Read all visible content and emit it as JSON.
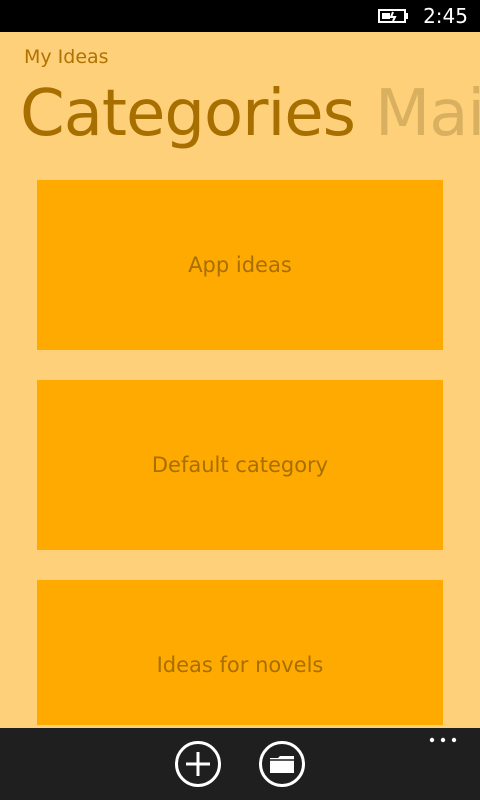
{
  "status_bar": {
    "time": "2:45",
    "battery_icon": "battery-charging-icon"
  },
  "app": {
    "title": "My Ideas"
  },
  "pivot": {
    "items": [
      {
        "label": "Categories",
        "active": true
      },
      {
        "label": "Mai",
        "active": false
      }
    ]
  },
  "categories": [
    {
      "label": "App ideas"
    },
    {
      "label": "Default category"
    },
    {
      "label": "Ideas for novels"
    }
  ],
  "app_bar": {
    "buttons": [
      {
        "icon": "add-icon"
      },
      {
        "icon": "folder-icon"
      }
    ],
    "more_icon": "ellipsis-icon"
  },
  "colors": {
    "background": "#ffd07a",
    "tile": "#ffaa00",
    "accent_text": "#a76e00",
    "app_bar": "#1f1f1f"
  }
}
